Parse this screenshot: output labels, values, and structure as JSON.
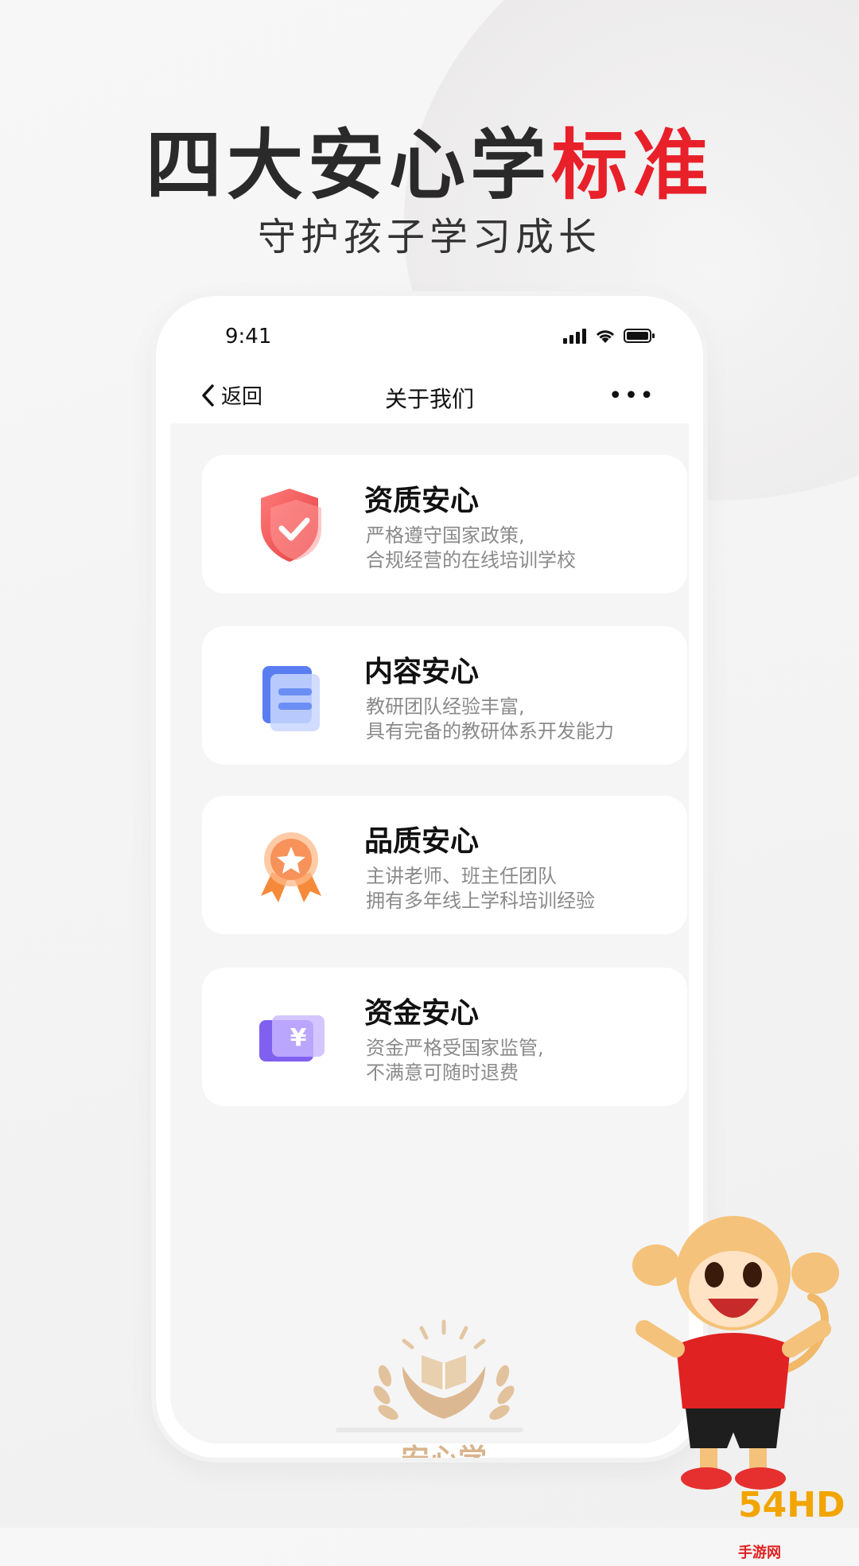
{
  "promo": {
    "headline_dark": "四大安心学",
    "headline_red": "标准",
    "subheadline": "守护孩子学习成长"
  },
  "status_bar": {
    "time": "9:41"
  },
  "nav": {
    "back_label": "返回",
    "title": "关于我们",
    "more_label": "•••"
  },
  "cards": [
    {
      "title": "资质安心",
      "line1": "严格遵守国家政策,",
      "line2": "合规经营的在线培训学校",
      "icon": "shield-check-icon",
      "color": "#f04848"
    },
    {
      "title": "内容安心",
      "line1": "教研团队经验丰富,",
      "line2": "具有完备的教研体系开发能力",
      "icon": "book-icon",
      "color": "#5b7ff0"
    },
    {
      "title": "品质安心",
      "line1": "主讲老师、班主任团队",
      "line2": "拥有多年线上学科培训经验",
      "icon": "medal-star-icon",
      "color": "#f59a48"
    },
    {
      "title": "资金安心",
      "line1": "资金严格受国家监管,",
      "line2": "不满意可随时退费",
      "icon": "yuan-money-icon",
      "color": "#8a6cf0"
    }
  ],
  "logo": {
    "text": "安心学"
  },
  "watermark": {
    "main": "54HD",
    "sub": "手游网"
  }
}
